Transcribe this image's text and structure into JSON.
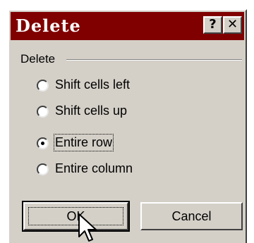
{
  "dialog": {
    "title": "Delete",
    "help_icon": "?",
    "close_icon": "✕",
    "group_label": "Delete",
    "options": [
      {
        "label": "Shift cells left",
        "checked": false
      },
      {
        "label": "Shift cells up",
        "checked": false
      },
      {
        "label": "Entire row",
        "checked": true
      },
      {
        "label": "Entire column",
        "checked": false
      }
    ],
    "ok_label": "OK",
    "cancel_label": "Cancel"
  },
  "colors": {
    "titlebar": "#800000",
    "face": "#d4d0c8"
  }
}
